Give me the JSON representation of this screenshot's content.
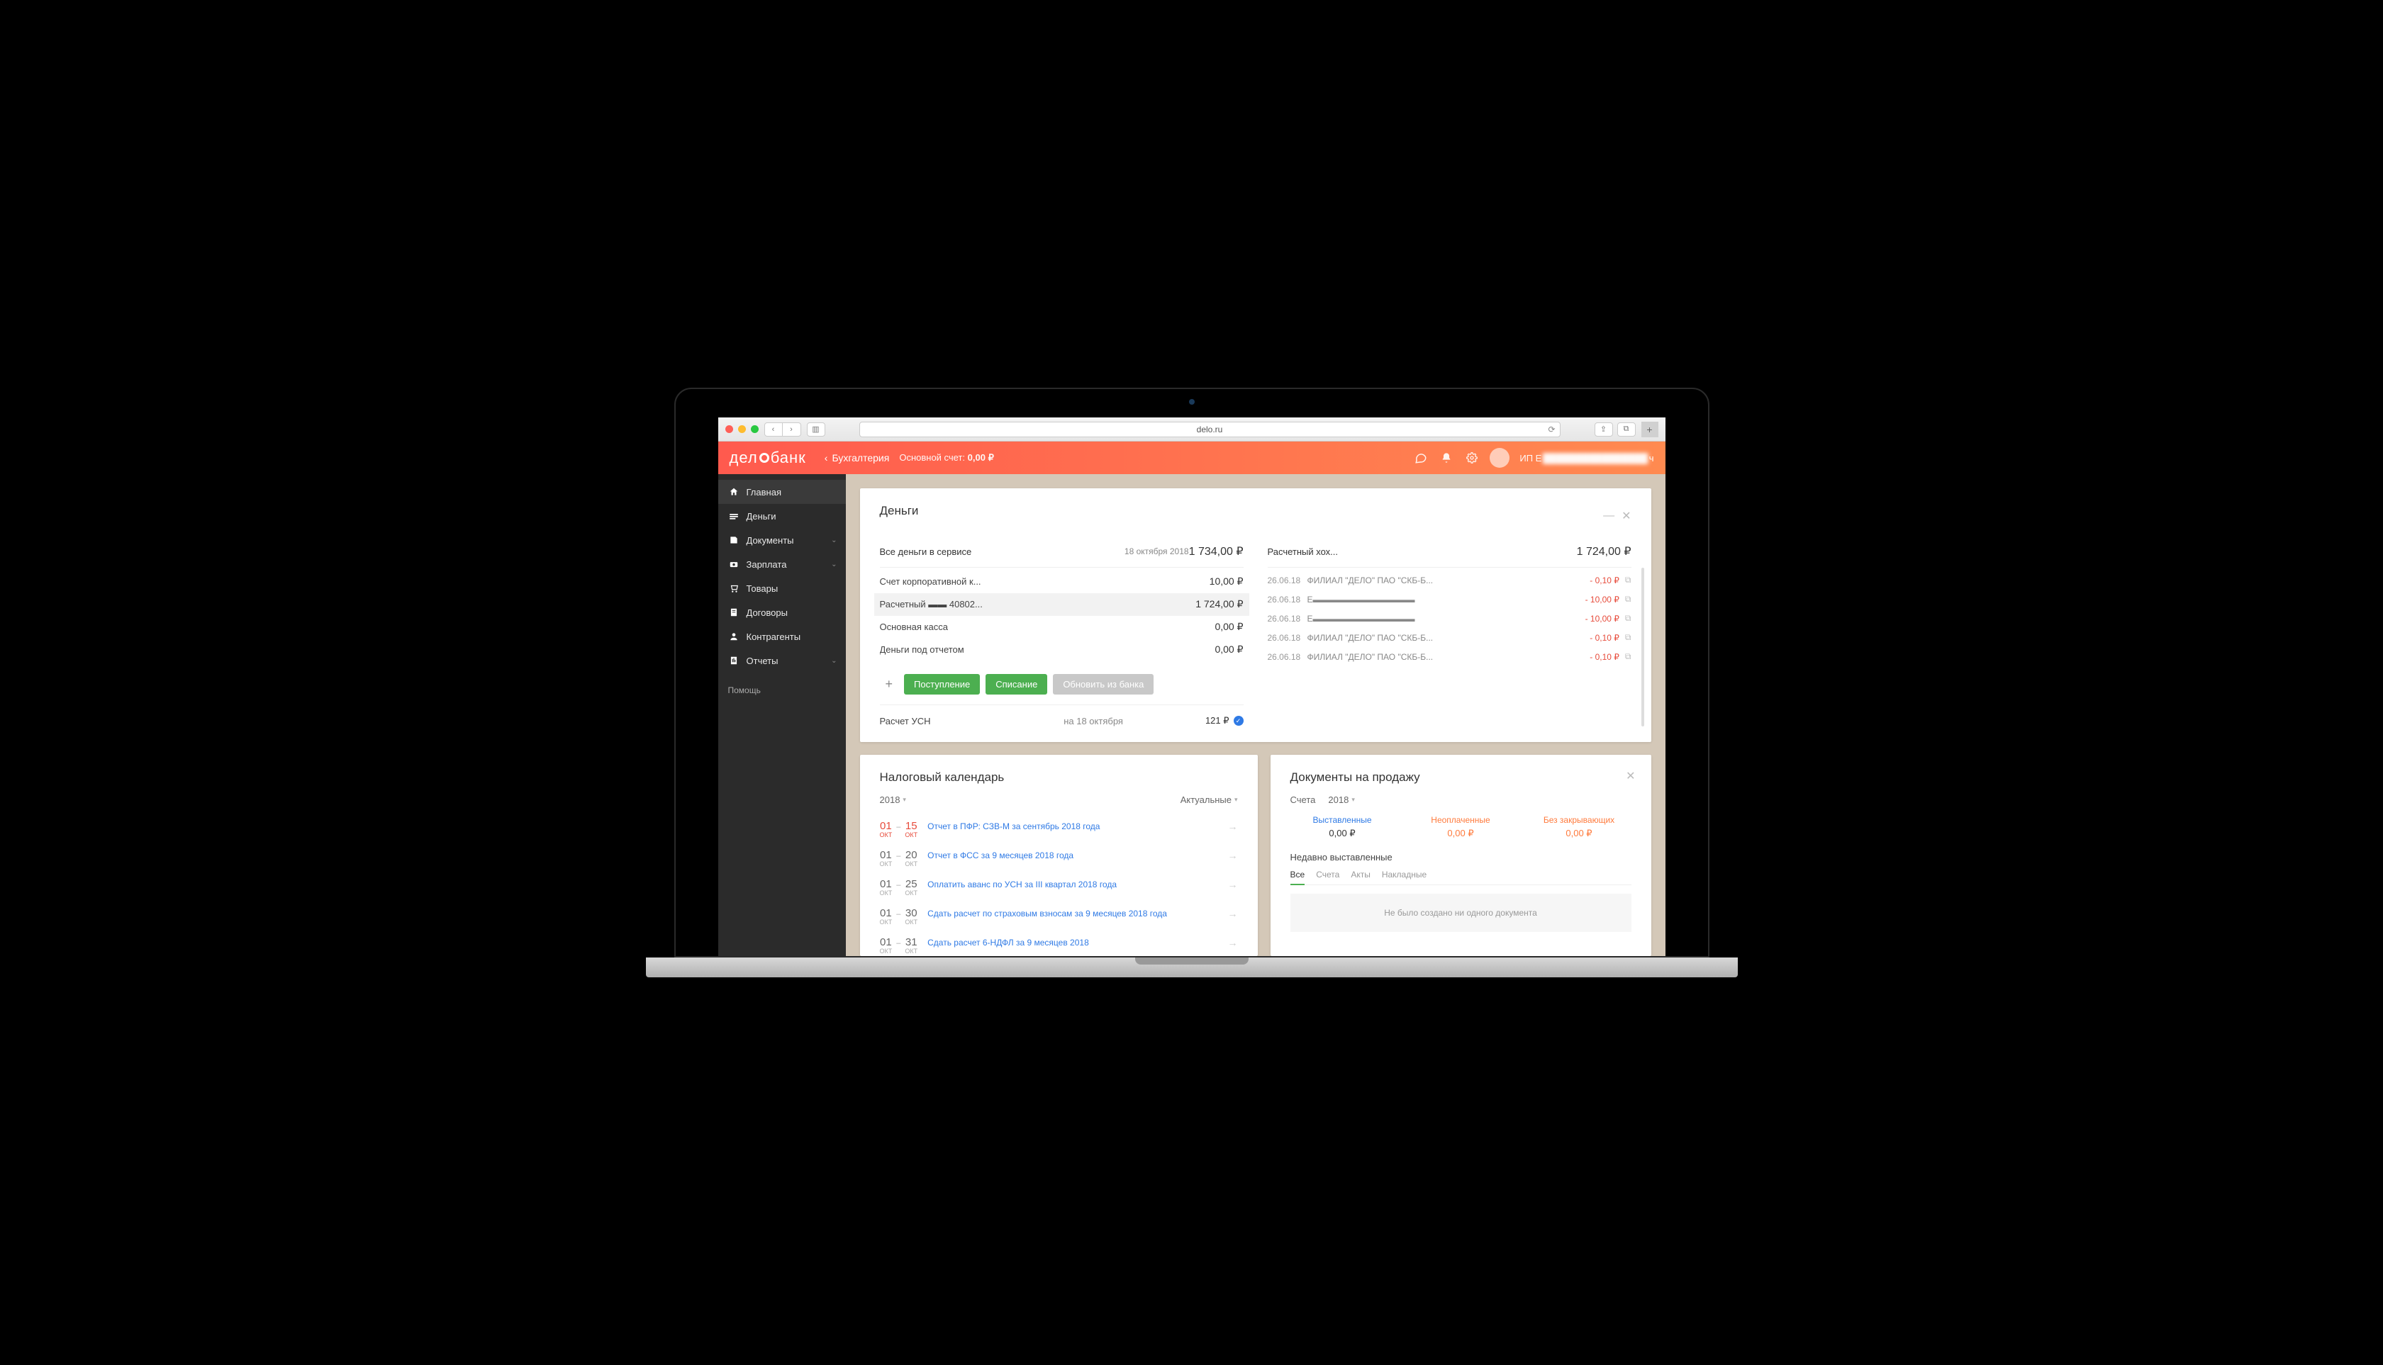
{
  "browser": {
    "url": "delo.ru"
  },
  "topbar": {
    "logo": "дело банк",
    "back": "Бухгалтерия",
    "account_label": "Основной счет:",
    "account_value": "0,00 ₽",
    "user_prefix": "ИП Е",
    "user_suffix": "ч"
  },
  "sidebar": {
    "items": [
      {
        "icon": "home-icon",
        "label": "Главная",
        "active": true
      },
      {
        "icon": "money-icon",
        "label": "Деньги"
      },
      {
        "icon": "docs-icon",
        "label": "Документы",
        "expandable": true
      },
      {
        "icon": "salary-icon",
        "label": "Зарплата",
        "expandable": true
      },
      {
        "icon": "goods-icon",
        "label": "Товары"
      },
      {
        "icon": "contract-icon",
        "label": "Договоры"
      },
      {
        "icon": "partners-icon",
        "label": "Контрагенты"
      },
      {
        "icon": "reports-icon",
        "label": "Отчеты",
        "expandable": true
      }
    ],
    "help": "Помощь"
  },
  "money": {
    "title": "Деньги",
    "total_label": "Все деньги в сервисе",
    "total_date": "18 октября 2018",
    "total_amount": "1 734,00",
    "rows": [
      {
        "label": "Счет корпоративной к...",
        "amount": "10,00"
      },
      {
        "label": "Расчетный ▬▬ 40802...",
        "amount": "1 724,00",
        "selected": true
      },
      {
        "label": "Основная касса",
        "amount": "0,00"
      },
      {
        "label": "Деньги под отчетом",
        "amount": "0,00"
      }
    ],
    "actions": {
      "in": "Поступление",
      "out": "Списание",
      "refresh": "Обновить из банка"
    },
    "usn": {
      "label": "Расчет УСН",
      "date": "на 18 октября",
      "amount": "121 ₽"
    },
    "right_title": "Расчетный хох...",
    "right_amount": "1 724,00",
    "tx": [
      {
        "date": "26.06.18",
        "name": "ФИЛИАЛ \"ДЕЛО\" ПАО \"СКБ-Б...",
        "amount": "- 0,10 ₽"
      },
      {
        "date": "26.06.18",
        "name": "Е▬▬▬▬▬▬▬▬▬▬▬▬",
        "amount": "- 10,00 ₽"
      },
      {
        "date": "26.06.18",
        "name": "Е▬▬▬▬▬▬▬▬▬▬▬▬",
        "amount": "- 10,00 ₽"
      },
      {
        "date": "26.06.18",
        "name": "ФИЛИАЛ \"ДЕЛО\" ПАО \"СКБ-Б...",
        "amount": "- 0,10 ₽"
      },
      {
        "date": "26.06.18",
        "name": "ФИЛИАЛ \"ДЕЛО\" ПАО \"СКБ-Б...",
        "amount": "- 0,10 ₽"
      }
    ]
  },
  "calendar": {
    "title": "Налоговый календарь",
    "year": "2018",
    "filter": "Актуальные",
    "items": [
      {
        "d1": "01",
        "m1": "ОКТ",
        "d2": "15",
        "m2": "ОКТ",
        "red": true,
        "text": "Отчет в ПФР: СЗВ-М за сентябрь 2018 года"
      },
      {
        "d1": "01",
        "m1": "ОКТ",
        "d2": "20",
        "m2": "ОКТ",
        "text": "Отчет в ФСС за 9 месяцев 2018 года"
      },
      {
        "d1": "01",
        "m1": "ОКТ",
        "d2": "25",
        "m2": "ОКТ",
        "text": "Оплатить аванс по УСН за III квартал 2018 года"
      },
      {
        "d1": "01",
        "m1": "ОКТ",
        "d2": "30",
        "m2": "ОКТ",
        "text": "Сдать расчет по страховым взносам за 9 месяцев 2018 года"
      },
      {
        "d1": "01",
        "m1": "ОКТ",
        "d2": "31",
        "m2": "ОКТ",
        "text": "Сдать расчет 6-НДФЛ за 9 месяцев 2018"
      }
    ]
  },
  "docs": {
    "title": "Документы на продажу",
    "type": "Счета",
    "year": "2018",
    "stats": [
      {
        "label": "Выставленные",
        "value": "0,00 ₽"
      },
      {
        "label": "Неоплаченные",
        "value": "0,00 ₽",
        "orange": true
      },
      {
        "label": "Без закрывающих",
        "value": "0,00 ₽",
        "orange": true
      }
    ],
    "recent": "Недавно выставленные",
    "tabs": [
      "Все",
      "Счета",
      "Акты",
      "Накладные"
    ],
    "empty": "Не было создано ни одного документа"
  }
}
